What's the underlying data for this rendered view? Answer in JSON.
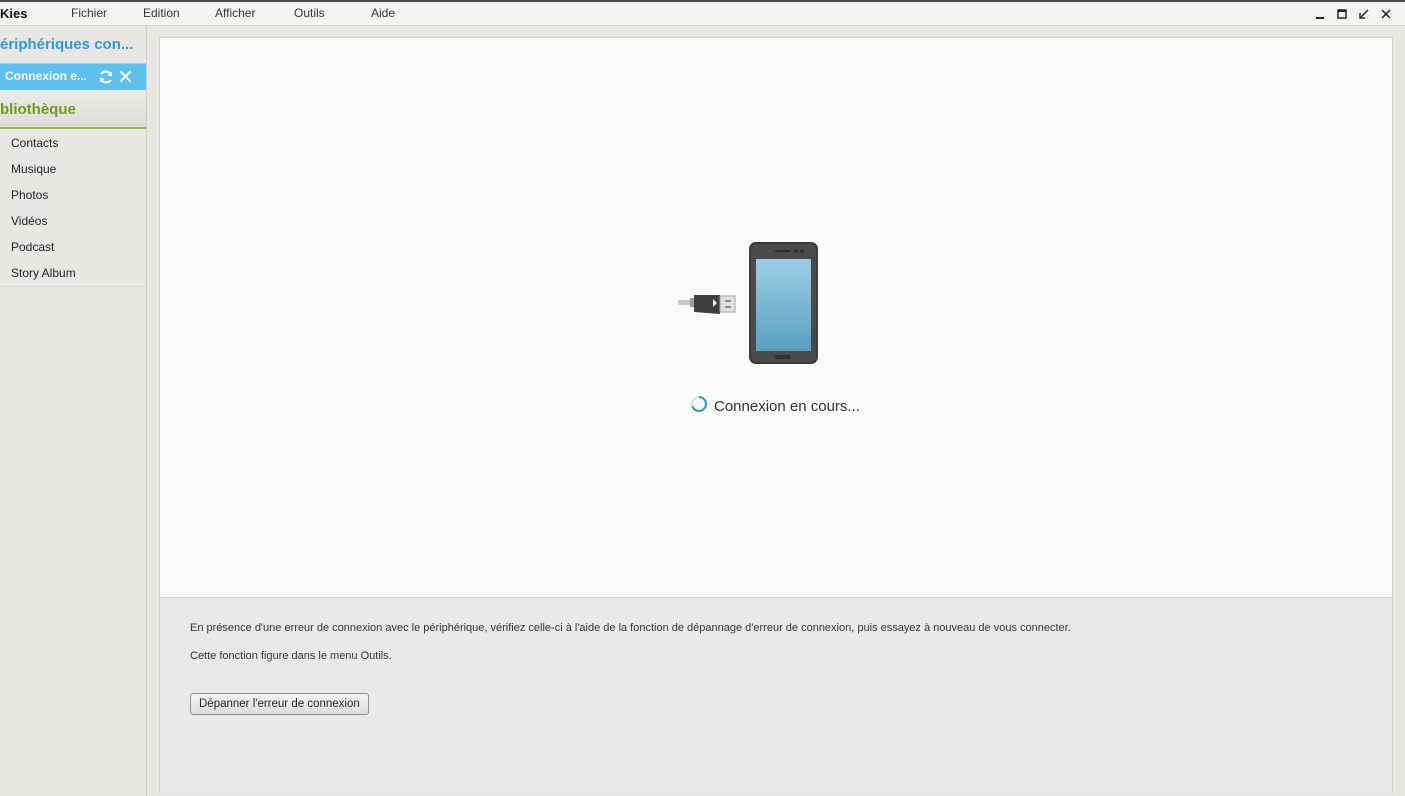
{
  "window": {
    "app_title": "Kies",
    "menu": [
      "Fichier",
      "Edition",
      "Afficher",
      "Outils",
      "Aide"
    ],
    "controls": [
      "minimize-icon",
      "maximize-icon",
      "restore-icon",
      "close-icon"
    ]
  },
  "sidebar": {
    "devices_header": "ériphériques con...",
    "device": {
      "label": "Connexion e...",
      "icons": [
        "refresh-icon",
        "close-icon"
      ]
    },
    "library_header": "bliothèque",
    "library_items": [
      "Contacts",
      "Musique",
      "Photos",
      "Vidéos",
      "Podcast",
      "Story Album"
    ]
  },
  "main": {
    "status_text": "Connexion en cours...",
    "info_line_1": "En présence d'une erreur de connexion avec le périphérique, vérifiez celle-ci à l'aide de la fonction de dépannage d'erreur de connexion, puis essayez à nouveau de vous connecter.",
    "info_line_2": "Cette fonction figure dans le menu Outils.",
    "troubleshoot_button": "Dépanner l'erreur de connexion"
  },
  "colors": {
    "device_accent": "#5ec0ee",
    "devices_header": "#2a9ad6",
    "library_header": "#6a9c1c",
    "spinner": "#2a9ad6"
  }
}
